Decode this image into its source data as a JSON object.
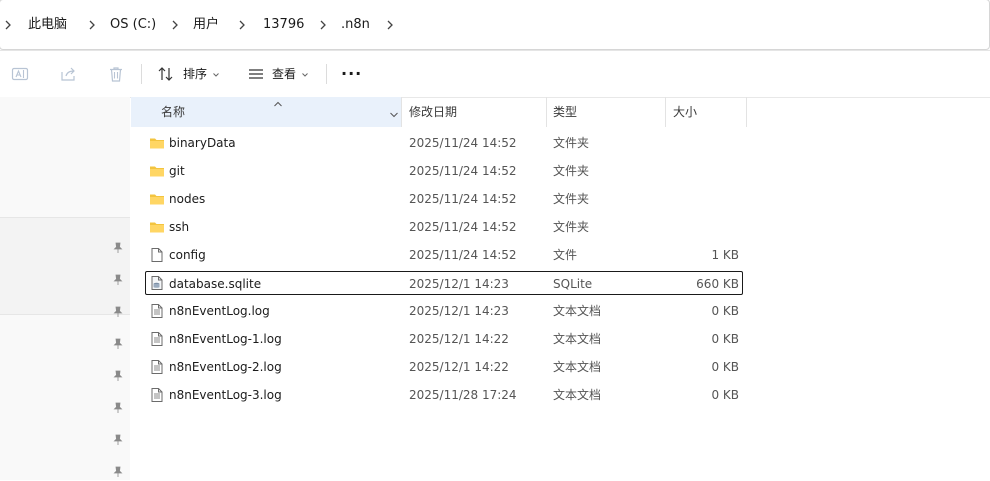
{
  "breadcrumb": [
    "此电脑",
    "OS (C:)",
    "用户",
    "13796",
    ".n8n"
  ],
  "toolbar": {
    "sort_label": "排序",
    "view_label": "查看",
    "more_label": "···"
  },
  "columns": {
    "name": "名称",
    "date": "修改日期",
    "type": "类型",
    "size": "大小"
  },
  "files": [
    {
      "name": "binaryData",
      "date": "2025/11/24 14:52",
      "type": "文件夹",
      "size": "",
      "icon": "folder-icon"
    },
    {
      "name": "git",
      "date": "2025/11/24 14:52",
      "type": "文件夹",
      "size": "",
      "icon": "folder-icon"
    },
    {
      "name": "nodes",
      "date": "2025/11/24 14:52",
      "type": "文件夹",
      "size": "",
      "icon": "folder-icon"
    },
    {
      "name": "ssh",
      "date": "2025/11/24 14:52",
      "type": "文件夹",
      "size": "",
      "icon": "folder-icon"
    },
    {
      "name": "config",
      "date": "2025/11/24 14:52",
      "type": "文件",
      "size": "1 KB",
      "icon": "file-icon"
    },
    {
      "name": "database.sqlite",
      "date": "2025/12/1 14:23",
      "type": "SQLite",
      "size": "660 KB",
      "icon": "sqlite-icon"
    },
    {
      "name": "n8nEventLog.log",
      "date": "2025/12/1 14:23",
      "type": "文本文档",
      "size": "0 KB",
      "icon": "text-file-icon"
    },
    {
      "name": "n8nEventLog-1.log",
      "date": "2025/12/1 14:22",
      "type": "文本文档",
      "size": "0 KB",
      "icon": "text-file-icon"
    },
    {
      "name": "n8nEventLog-2.log",
      "date": "2025/12/1 14:22",
      "type": "文本文档",
      "size": "0 KB",
      "icon": "text-file-icon"
    },
    {
      "name": "n8nEventLog-3.log",
      "date": "2025/11/28 17:24",
      "type": "文本文档",
      "size": "0 KB",
      "icon": "text-file-icon"
    }
  ],
  "colors": {
    "folder": "#f3c43f",
    "selection_border": "#1a1a1a",
    "header_hover": "#e9f1fb"
  }
}
